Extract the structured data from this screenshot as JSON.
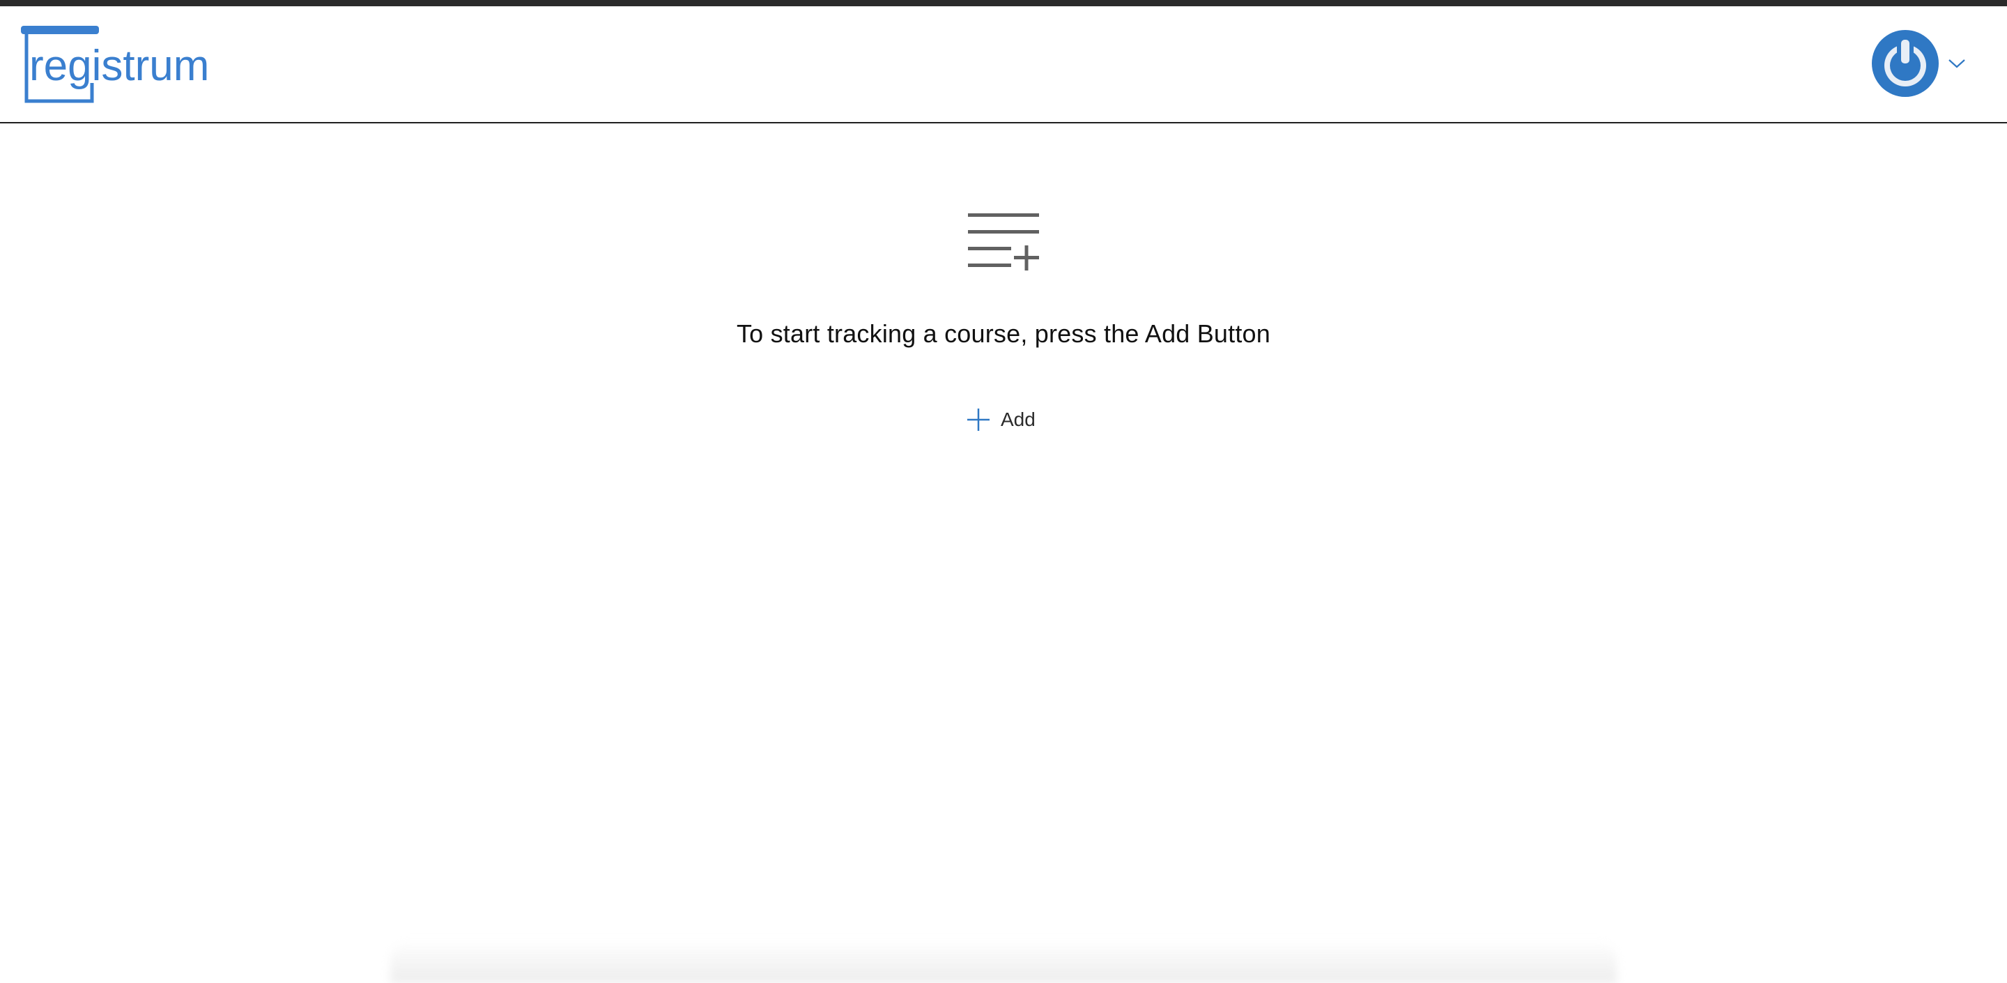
{
  "header": {
    "logo_text": "registrum",
    "brand_color": "#3a7fcf",
    "user_menu": {
      "avatar_icon": "power-icon",
      "dropdown_icon": "chevron-down-icon"
    }
  },
  "main": {
    "empty_state": {
      "icon": "list-add-icon",
      "message": "To start tracking a course, press the Add Button",
      "add_button_label": "Add"
    }
  },
  "colors": {
    "icon_gray": "#616161",
    "accent": "#2f78c4"
  }
}
